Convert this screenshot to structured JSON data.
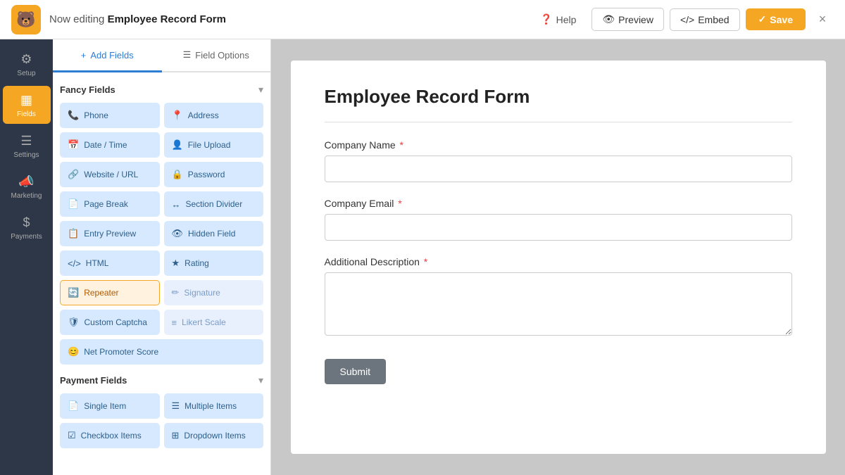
{
  "topbar": {
    "logo_emoji": "🐻",
    "editing_prefix": "Now editing",
    "form_name": "Employee Record Form",
    "help_label": "Help",
    "preview_label": "Preview",
    "embed_label": "Embed",
    "save_label": "Save",
    "close_label": "×"
  },
  "nav": {
    "items": [
      {
        "id": "setup",
        "icon": "⚙",
        "label": "Setup",
        "active": false
      },
      {
        "id": "fields",
        "icon": "▦",
        "label": "Fields",
        "active": true
      },
      {
        "id": "settings",
        "icon": "☰",
        "label": "Settings",
        "active": false
      },
      {
        "id": "marketing",
        "icon": "📣",
        "label": "Marketing",
        "active": false
      },
      {
        "id": "payments",
        "icon": "$",
        "label": "Payments",
        "active": false
      }
    ]
  },
  "panel": {
    "tab_add_fields": "Add Fields",
    "tab_field_options": "Field Options",
    "fancy_fields_title": "Fancy Fields",
    "payment_fields_title": "Payment Fields",
    "fancy_fields": [
      {
        "id": "phone",
        "icon": "📞",
        "label": "Phone"
      },
      {
        "id": "address",
        "icon": "📍",
        "label": "Address"
      },
      {
        "id": "datetime",
        "icon": "📅",
        "label": "Date / Time"
      },
      {
        "id": "file-upload",
        "icon": "👤",
        "label": "File Upload"
      },
      {
        "id": "website-url",
        "icon": "🔗",
        "label": "Website / URL"
      },
      {
        "id": "password",
        "icon": "🔒",
        "label": "Password"
      },
      {
        "id": "page-break",
        "icon": "📄",
        "label": "Page Break"
      },
      {
        "id": "section-divider",
        "icon": "↔",
        "label": "Section Divider"
      },
      {
        "id": "entry-preview",
        "icon": "📋",
        "label": "Entry Preview"
      },
      {
        "id": "hidden-field",
        "icon": "👁",
        "label": "Hidden Field"
      },
      {
        "id": "html",
        "icon": "</>",
        "label": "HTML"
      },
      {
        "id": "rating",
        "icon": "★",
        "label": "Rating"
      },
      {
        "id": "repeater",
        "icon": "🔄",
        "label": "Repeater",
        "selected": true
      },
      {
        "id": "signature",
        "icon": "✏",
        "label": "Signature",
        "disabled": true
      },
      {
        "id": "custom-captcha",
        "icon": "🛡",
        "label": "Custom Captcha"
      },
      {
        "id": "likert-scale",
        "icon": "≡",
        "label": "Likert Scale",
        "disabled": true
      },
      {
        "id": "net-promoter-score",
        "icon": "😊",
        "label": "Net Promoter Score"
      }
    ],
    "payment_fields": [
      {
        "id": "single-item",
        "icon": "📄",
        "label": "Single Item"
      },
      {
        "id": "multiple-items",
        "icon": "☰",
        "label": "Multiple Items"
      },
      {
        "id": "checkbox-items",
        "icon": "☑",
        "label": "Checkbox Items"
      },
      {
        "id": "dropdown-items",
        "icon": "⊞",
        "label": "Dropdown Items"
      }
    ]
  },
  "form": {
    "title": "Employee Record Form",
    "fields": [
      {
        "id": "company-name",
        "label": "Company Name",
        "required": true,
        "type": "input"
      },
      {
        "id": "company-email",
        "label": "Company Email",
        "required": true,
        "type": "input"
      },
      {
        "id": "additional-desc",
        "label": "Additional Description",
        "required": true,
        "type": "textarea"
      }
    ],
    "submit_label": "Submit"
  }
}
